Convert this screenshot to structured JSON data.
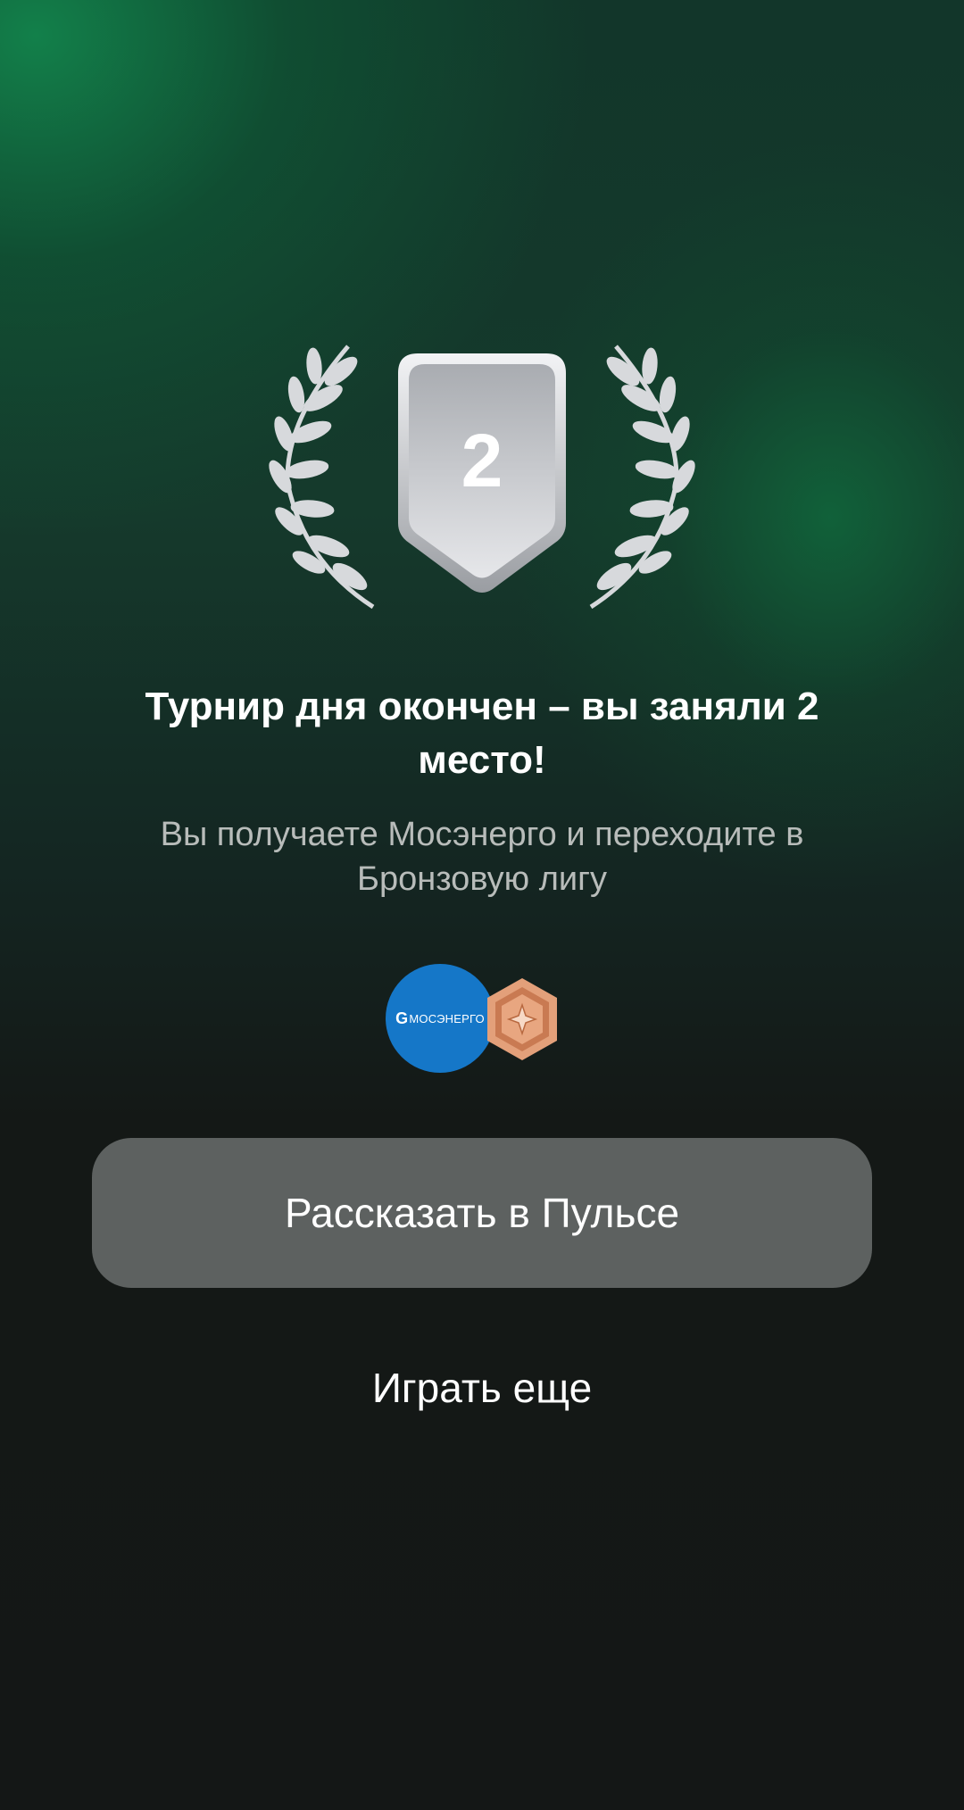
{
  "award": {
    "place": "2"
  },
  "result": {
    "title": "Турнир дня окончен – вы заняли 2 место!",
    "subtitle": "Вы получаете Мосэнерго и переходите в Бронзовую лигу"
  },
  "rewards": {
    "coin_label": "МОСЭНЕРГО",
    "coin_color": "#1577c8",
    "league_color": "#d58a62"
  },
  "actions": {
    "share_label": "Рассказать в Пульсе",
    "play_again_label": "Играть еще"
  }
}
